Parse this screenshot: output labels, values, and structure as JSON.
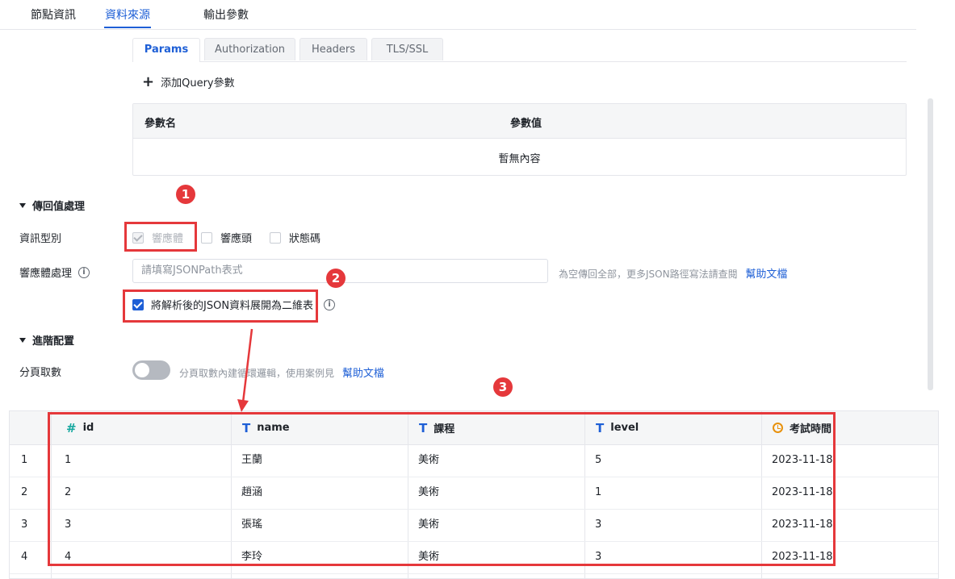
{
  "top_tabs": [
    "節點資訊",
    "資料來源",
    "輸出參數"
  ],
  "sub_tabs": [
    "Params",
    "Authorization",
    "Headers",
    "TLS/SSL"
  ],
  "add_query": "添加Query參數",
  "param_table": {
    "col_name": "參數名",
    "col_value": "參數值",
    "empty": "暫無內容"
  },
  "return_section": {
    "title": "傳回值處理",
    "data_type_label": "資訊型別",
    "options": [
      "響應體",
      "響應頭",
      "狀態碼"
    ],
    "body_process_label": "響應體處理",
    "jsonpath_placeholder": "請填寫JSONPath表式",
    "hint": "為空傳回全部，更多JSON路徑寫法請查閱",
    "help_link": "幫助文檔",
    "flatten_label": "將解析後的JSON資料展開為二維表",
    "flatten_checked": true
  },
  "advanced_section": {
    "title": "進階配置",
    "paging_label": "分頁取數",
    "paging_hint": "分頁取數內建循環邏輯，使用案例見",
    "help_link": "幫助文檔",
    "paging_enabled": false
  },
  "badges": [
    "1",
    "2",
    "3"
  ],
  "grid": {
    "columns": [
      {
        "name": "id",
        "type": "number"
      },
      {
        "name": "name",
        "type": "text"
      },
      {
        "name": "課程",
        "type": "text"
      },
      {
        "name": "level",
        "type": "text"
      },
      {
        "name": "考試時間",
        "type": "date"
      }
    ],
    "rows": [
      {
        "n": "1",
        "id": "1",
        "name": "王蘭",
        "course": "美術",
        "level": "5",
        "date": "2023-11-18"
      },
      {
        "n": "2",
        "id": "2",
        "name": "趙涵",
        "course": "美術",
        "level": "1",
        "date": "2023-11-18"
      },
      {
        "n": "3",
        "id": "3",
        "name": "張瑤",
        "course": "美術",
        "level": "3",
        "date": "2023-11-18"
      },
      {
        "n": "4",
        "id": "4",
        "name": "李玲",
        "course": "美術",
        "level": "3",
        "date": "2023-11-18"
      }
    ]
  },
  "colors": {
    "accent": "#1e5fd6",
    "annotation_red": "#e5383b"
  }
}
